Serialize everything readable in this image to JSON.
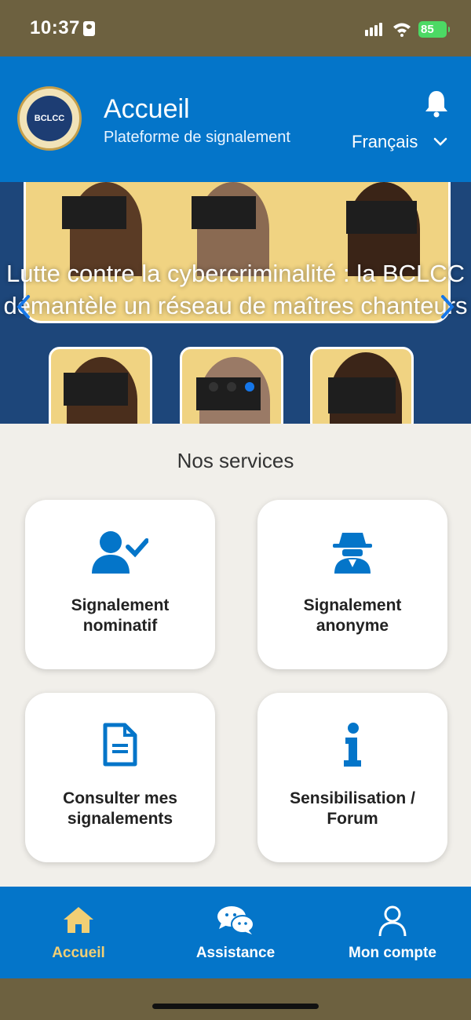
{
  "status_bar": {
    "time": "10:37",
    "battery": "85"
  },
  "header": {
    "logo_text": "BCLCC",
    "title": "Accueil",
    "subtitle": "Plateforme de signalement",
    "language": "Français"
  },
  "carousel": {
    "caption": "Lutte contre la cybercriminalité : la BCLCC démantèle un réseau de maîtres chanteurs",
    "slide_count": 3,
    "active_slide": 3
  },
  "services": {
    "title": "Nos services",
    "cards": [
      {
        "label": "Signalement nominatif",
        "icon": "user-check-icon"
      },
      {
        "label": "Signalement anonyme",
        "icon": "incognito-spy-icon"
      },
      {
        "label": "Consulter mes signalements",
        "icon": "document-icon"
      },
      {
        "label": "Sensibilisation / Forum",
        "icon": "info-icon"
      }
    ]
  },
  "bottom_nav": {
    "items": [
      {
        "label": "Accueil",
        "icon": "home-icon",
        "active": true
      },
      {
        "label": "Assistance",
        "icon": "chat-icon",
        "active": false
      },
      {
        "label": "Mon compte",
        "icon": "user-icon",
        "active": false
      }
    ]
  },
  "colors": {
    "primary": "#0475c9",
    "accent": "#f1cf75",
    "background": "#f1efea",
    "card": "#ffffff"
  }
}
